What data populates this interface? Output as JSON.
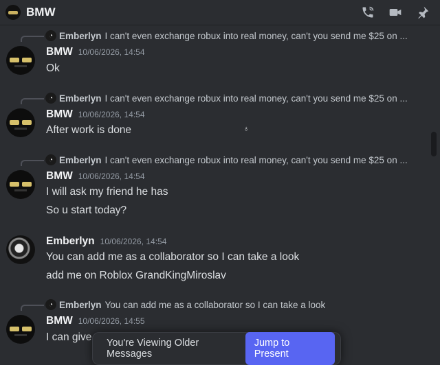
{
  "header": {
    "title": "BMW",
    "icons": [
      "phone-icon",
      "video-icon",
      "pin-icon"
    ]
  },
  "messages": [
    {
      "reply": {
        "name": "Emberlyn",
        "text": "I can't even exchange robux into real money, can't you send me $25 on ..."
      },
      "author": "BMW",
      "timestamp": "10/06/2026, 14:54",
      "lines": [
        "Ok"
      ]
    },
    {
      "reply": {
        "name": "Emberlyn",
        "text": "I can't even exchange robux into real money, can't you send me $25 on ..."
      },
      "author": "BMW",
      "timestamp": "10/06/2026, 14:54",
      "lines": [
        "After work is done"
      ]
    },
    {
      "reply": {
        "name": "Emberlyn",
        "text": "I can't even exchange robux into real money, can't you send me $25 on ..."
      },
      "author": "BMW",
      "timestamp": "10/06/2026, 14:54",
      "lines": [
        "I will ask my friend he has",
        "So u start today?"
      ]
    },
    {
      "author": "Emberlyn",
      "timestamp": "10/06/2026, 14:54",
      "lines": [
        "You can add me as a collaborator so I can take a look",
        "add me on Roblox GrandKingMiroslav"
      ]
    },
    {
      "reply": {
        "name": "Emberlyn",
        "text": "You can add me as a collaborator so I can take a look"
      },
      "author": "BMW",
      "timestamp": "10/06/2026, 14:55",
      "lines": [
        "I can give"
      ]
    }
  ],
  "banner": {
    "text": "You're Viewing Older Messages",
    "button": "Jump to Present"
  },
  "colors": {
    "background": "#2b2d31",
    "accent": "#5865f2",
    "text": "#dbdee1",
    "muted": "#949ba4"
  }
}
